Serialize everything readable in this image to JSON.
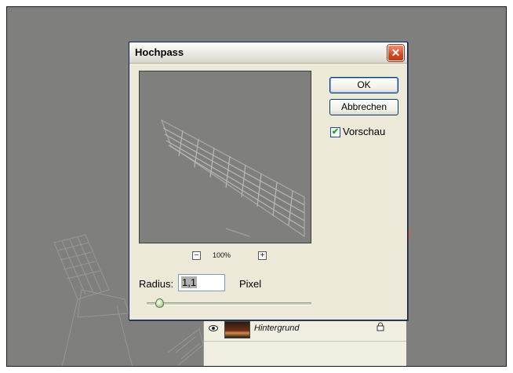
{
  "dialog": {
    "title": "Hochpass",
    "close_symbol": "✕",
    "buttons": {
      "ok": "OK",
      "cancel": "Abbrechen"
    },
    "preview_checkbox": {
      "label": "Vorschau",
      "checked": true,
      "check_symbol": "✔"
    },
    "zoom": {
      "minus": "−",
      "plus": "+",
      "level": "100%"
    },
    "radius": {
      "label": "Radius:",
      "value": "1,1",
      "unit": "Pixel"
    },
    "slider_fraction": 0.05
  },
  "layers_panel": {
    "layer": {
      "name": "Hintergrund",
      "visible_icon": "eye-icon",
      "lock_icon": "lock-icon"
    }
  },
  "colors": {
    "canvas_bg": "#7f7f7d",
    "dialog_bg": "#ece9d8",
    "close_red": "#d6481f",
    "button_border": "#003c74",
    "check_green": "#21a121"
  }
}
